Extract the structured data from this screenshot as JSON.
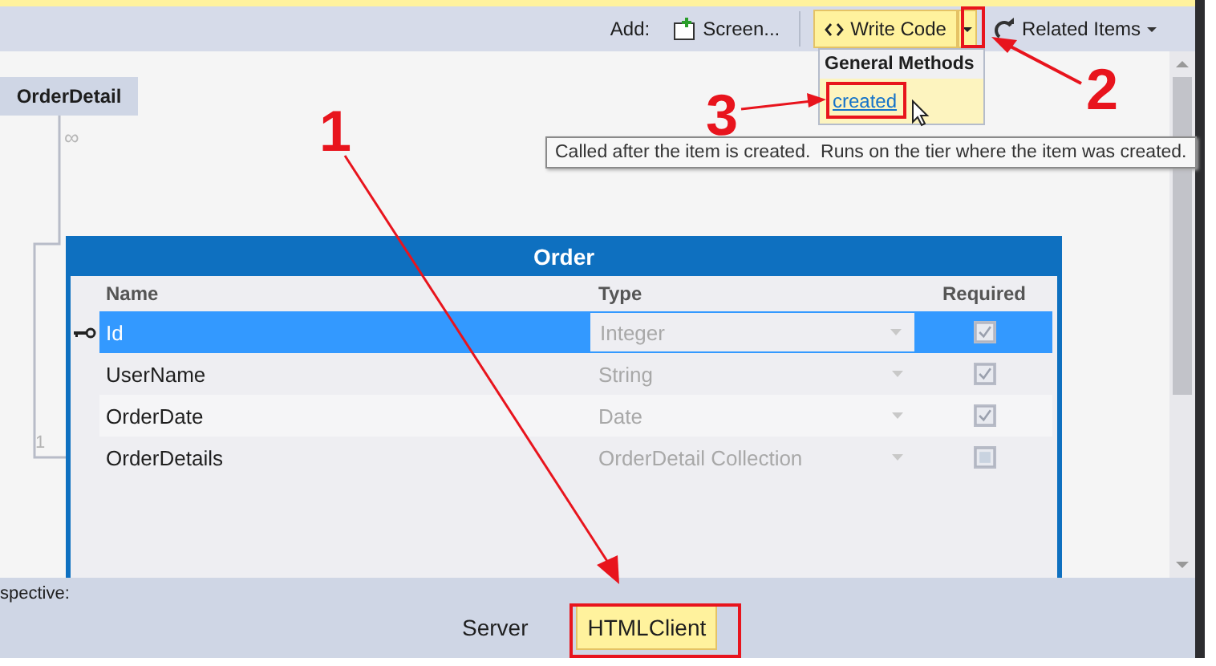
{
  "toolbar": {
    "add_label": "Add:",
    "buttons": [
      {
        "kind": "screen",
        "label": "Screen...",
        "expanded": false
      },
      {
        "kind": "split",
        "label": "Write Code",
        "expanded": true
      },
      {
        "kind": "menu",
        "label": "Related Items",
        "expanded": false
      }
    ]
  },
  "write_code_menu": {
    "heading": "General Methods",
    "items": [
      {
        "label": "created",
        "selected": true
      }
    ]
  },
  "tooltip": "Called after the item is created.  Runs on the tier where the item was created.",
  "related_entity": {
    "title": "OrderDetail",
    "many_label": "∞",
    "one_label": "1"
  },
  "entity": {
    "title": "Order",
    "columns": [
      "Name",
      "Type",
      "Required"
    ],
    "rows": [
      {
        "name": "Id",
        "type": "Integer",
        "required": true,
        "key": true,
        "selected": true
      },
      {
        "name": "UserName",
        "type": "String",
        "required": true,
        "key": false,
        "selected": false
      },
      {
        "name": "OrderDate",
        "type": "Date",
        "required": true,
        "key": false,
        "selected": false
      },
      {
        "name": "OrderDetails",
        "type": "OrderDetail Collection",
        "required": false,
        "key": false,
        "selected": false
      }
    ]
  },
  "perspective": {
    "label": "spective:",
    "tabs": [
      {
        "label": "Server",
        "selected": false
      },
      {
        "label": "HTMLClient",
        "selected": true
      }
    ]
  },
  "annotations": [
    {
      "label": "1"
    },
    {
      "label": "2"
    },
    {
      "label": "3"
    }
  ]
}
